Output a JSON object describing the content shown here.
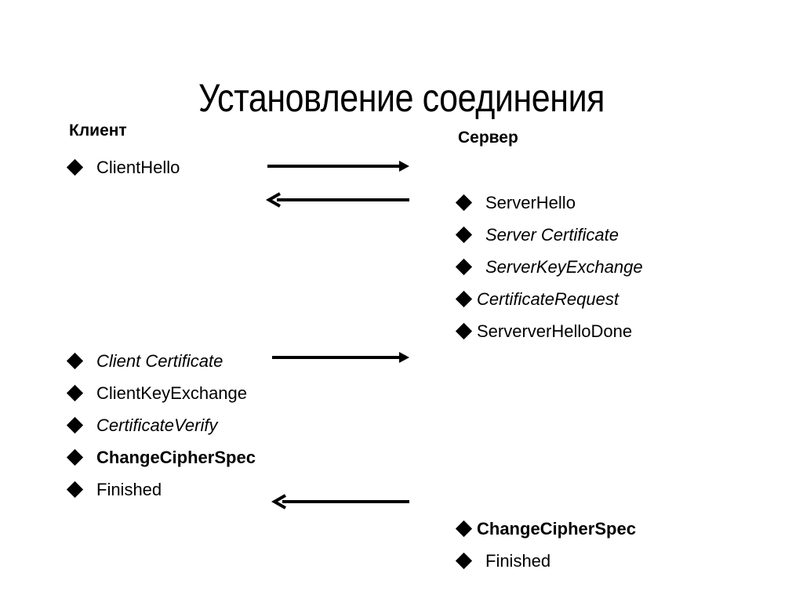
{
  "slide": {
    "title": "Установление соединения",
    "background_color": "#ffffff",
    "text_color": "#000000"
  },
  "client_column": {
    "header": "Клиент",
    "messages_top": [
      {
        "label": "ClientHello",
        "style": "regular"
      }
    ],
    "messages_bottom": [
      {
        "label": "Client Certificate",
        "style": "italic"
      },
      {
        "label": "ClientKeyExchange",
        "style": "regular"
      },
      {
        "label": "CertificateVerify",
        "style": "italic"
      },
      {
        "label": "ChangeCipherSpec",
        "style": "bold"
      },
      {
        "label": "Finished",
        "style": "regular"
      }
    ]
  },
  "server_column": {
    "header": "Сервер",
    "messages_top": [
      {
        "label": "ServerHello",
        "style": "regular"
      },
      {
        "label": "Server Certificate",
        "style": "italic"
      },
      {
        "label": "ServerKeyExchange",
        "style": "italic"
      },
      {
        "label": "CertificateRequest",
        "style": "italic"
      },
      {
        "label": "SerververHelloDone",
        "style": "regular"
      }
    ],
    "messages_bottom": [
      {
        "label": "ChangeCipherSpec",
        "style": "bold"
      },
      {
        "label": "Finished",
        "style": "regular"
      }
    ]
  },
  "arrows": [
    {
      "name": "arrow-client-to-server-1",
      "direction": "right"
    },
    {
      "name": "arrow-server-to-client-1",
      "direction": "left"
    },
    {
      "name": "arrow-client-to-server-2",
      "direction": "right"
    },
    {
      "name": "arrow-server-to-client-2",
      "direction": "left"
    }
  ]
}
